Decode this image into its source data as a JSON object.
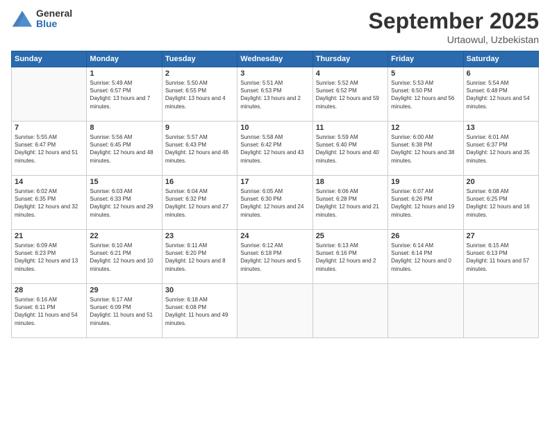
{
  "logo": {
    "general": "General",
    "blue": "Blue"
  },
  "title": "September 2025",
  "location": "Urtaowul, Uzbekistan",
  "header": {
    "days": [
      "Sunday",
      "Monday",
      "Tuesday",
      "Wednesday",
      "Thursday",
      "Friday",
      "Saturday"
    ]
  },
  "weeks": [
    [
      {
        "day": "",
        "sunrise": "",
        "sunset": "",
        "daylight": ""
      },
      {
        "day": "1",
        "sunrise": "Sunrise: 5:49 AM",
        "sunset": "Sunset: 6:57 PM",
        "daylight": "Daylight: 13 hours and 7 minutes."
      },
      {
        "day": "2",
        "sunrise": "Sunrise: 5:50 AM",
        "sunset": "Sunset: 6:55 PM",
        "daylight": "Daylight: 13 hours and 4 minutes."
      },
      {
        "day": "3",
        "sunrise": "Sunrise: 5:51 AM",
        "sunset": "Sunset: 6:53 PM",
        "daylight": "Daylight: 13 hours and 2 minutes."
      },
      {
        "day": "4",
        "sunrise": "Sunrise: 5:52 AM",
        "sunset": "Sunset: 6:52 PM",
        "daylight": "Daylight: 12 hours and 59 minutes."
      },
      {
        "day": "5",
        "sunrise": "Sunrise: 5:53 AM",
        "sunset": "Sunset: 6:50 PM",
        "daylight": "Daylight: 12 hours and 56 minutes."
      },
      {
        "day": "6",
        "sunrise": "Sunrise: 5:54 AM",
        "sunset": "Sunset: 6:48 PM",
        "daylight": "Daylight: 12 hours and 54 minutes."
      }
    ],
    [
      {
        "day": "7",
        "sunrise": "Sunrise: 5:55 AM",
        "sunset": "Sunset: 6:47 PM",
        "daylight": "Daylight: 12 hours and 51 minutes."
      },
      {
        "day": "8",
        "sunrise": "Sunrise: 5:56 AM",
        "sunset": "Sunset: 6:45 PM",
        "daylight": "Daylight: 12 hours and 48 minutes."
      },
      {
        "day": "9",
        "sunrise": "Sunrise: 5:57 AM",
        "sunset": "Sunset: 6:43 PM",
        "daylight": "Daylight: 12 hours and 46 minutes."
      },
      {
        "day": "10",
        "sunrise": "Sunrise: 5:58 AM",
        "sunset": "Sunset: 6:42 PM",
        "daylight": "Daylight: 12 hours and 43 minutes."
      },
      {
        "day": "11",
        "sunrise": "Sunrise: 5:59 AM",
        "sunset": "Sunset: 6:40 PM",
        "daylight": "Daylight: 12 hours and 40 minutes."
      },
      {
        "day": "12",
        "sunrise": "Sunrise: 6:00 AM",
        "sunset": "Sunset: 6:38 PM",
        "daylight": "Daylight: 12 hours and 38 minutes."
      },
      {
        "day": "13",
        "sunrise": "Sunrise: 6:01 AM",
        "sunset": "Sunset: 6:37 PM",
        "daylight": "Daylight: 12 hours and 35 minutes."
      }
    ],
    [
      {
        "day": "14",
        "sunrise": "Sunrise: 6:02 AM",
        "sunset": "Sunset: 6:35 PM",
        "daylight": "Daylight: 12 hours and 32 minutes."
      },
      {
        "day": "15",
        "sunrise": "Sunrise: 6:03 AM",
        "sunset": "Sunset: 6:33 PM",
        "daylight": "Daylight: 12 hours and 29 minutes."
      },
      {
        "day": "16",
        "sunrise": "Sunrise: 6:04 AM",
        "sunset": "Sunset: 6:32 PM",
        "daylight": "Daylight: 12 hours and 27 minutes."
      },
      {
        "day": "17",
        "sunrise": "Sunrise: 6:05 AM",
        "sunset": "Sunset: 6:30 PM",
        "daylight": "Daylight: 12 hours and 24 minutes."
      },
      {
        "day": "18",
        "sunrise": "Sunrise: 6:06 AM",
        "sunset": "Sunset: 6:28 PM",
        "daylight": "Daylight: 12 hours and 21 minutes."
      },
      {
        "day": "19",
        "sunrise": "Sunrise: 6:07 AM",
        "sunset": "Sunset: 6:26 PM",
        "daylight": "Daylight: 12 hours and 19 minutes."
      },
      {
        "day": "20",
        "sunrise": "Sunrise: 6:08 AM",
        "sunset": "Sunset: 6:25 PM",
        "daylight": "Daylight: 12 hours and 16 minutes."
      }
    ],
    [
      {
        "day": "21",
        "sunrise": "Sunrise: 6:09 AM",
        "sunset": "Sunset: 6:23 PM",
        "daylight": "Daylight: 12 hours and 13 minutes."
      },
      {
        "day": "22",
        "sunrise": "Sunrise: 6:10 AM",
        "sunset": "Sunset: 6:21 PM",
        "daylight": "Daylight: 12 hours and 10 minutes."
      },
      {
        "day": "23",
        "sunrise": "Sunrise: 6:11 AM",
        "sunset": "Sunset: 6:20 PM",
        "daylight": "Daylight: 12 hours and 8 minutes."
      },
      {
        "day": "24",
        "sunrise": "Sunrise: 6:12 AM",
        "sunset": "Sunset: 6:18 PM",
        "daylight": "Daylight: 12 hours and 5 minutes."
      },
      {
        "day": "25",
        "sunrise": "Sunrise: 6:13 AM",
        "sunset": "Sunset: 6:16 PM",
        "daylight": "Daylight: 12 hours and 2 minutes."
      },
      {
        "day": "26",
        "sunrise": "Sunrise: 6:14 AM",
        "sunset": "Sunset: 6:14 PM",
        "daylight": "Daylight: 12 hours and 0 minutes."
      },
      {
        "day": "27",
        "sunrise": "Sunrise: 6:15 AM",
        "sunset": "Sunset: 6:13 PM",
        "daylight": "Daylight: 11 hours and 57 minutes."
      }
    ],
    [
      {
        "day": "28",
        "sunrise": "Sunrise: 6:16 AM",
        "sunset": "Sunset: 6:11 PM",
        "daylight": "Daylight: 11 hours and 54 minutes."
      },
      {
        "day": "29",
        "sunrise": "Sunrise: 6:17 AM",
        "sunset": "Sunset: 6:09 PM",
        "daylight": "Daylight: 11 hours and 51 minutes."
      },
      {
        "day": "30",
        "sunrise": "Sunrise: 6:18 AM",
        "sunset": "Sunset: 6:08 PM",
        "daylight": "Daylight: 11 hours and 49 minutes."
      },
      {
        "day": "",
        "sunrise": "",
        "sunset": "",
        "daylight": ""
      },
      {
        "day": "",
        "sunrise": "",
        "sunset": "",
        "daylight": ""
      },
      {
        "day": "",
        "sunrise": "",
        "sunset": "",
        "daylight": ""
      },
      {
        "day": "",
        "sunrise": "",
        "sunset": "",
        "daylight": ""
      }
    ]
  ]
}
